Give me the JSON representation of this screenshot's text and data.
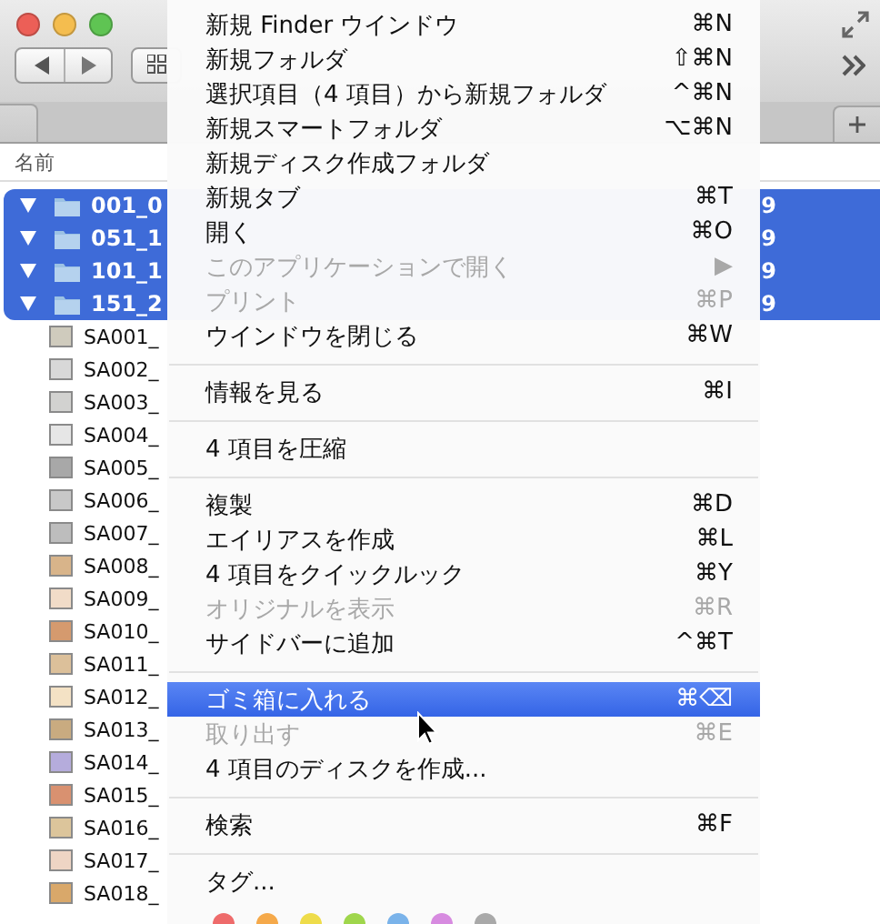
{
  "finder": {
    "column_header": "名前",
    "rows": [
      {
        "kind": "folder",
        "name": "001_0",
        "expanded": true,
        "selected": true,
        "column_2": "9"
      },
      {
        "kind": "folder",
        "name": "051_1",
        "expanded": true,
        "selected": true,
        "column_2": "9"
      },
      {
        "kind": "folder",
        "name": "101_1",
        "expanded": true,
        "selected": true,
        "column_2": "9"
      },
      {
        "kind": "folder",
        "name": "151_2",
        "expanded": true,
        "selected": true,
        "column_2": "9"
      },
      {
        "kind": "file",
        "name": "SA001_",
        "selected": false,
        "color": "#cfcbbd"
      },
      {
        "kind": "file",
        "name": "SA002_",
        "selected": false,
        "color": "#d8d8d8"
      },
      {
        "kind": "file",
        "name": "SA003_",
        "selected": false,
        "color": "#d2d2d0"
      },
      {
        "kind": "file",
        "name": "SA004_",
        "selected": false,
        "color": "#e6e6e6"
      },
      {
        "kind": "file",
        "name": "SA005_",
        "selected": false,
        "color": "#a8a8a8"
      },
      {
        "kind": "file",
        "name": "SA006_",
        "selected": false,
        "color": "#c8c8c8"
      },
      {
        "kind": "file",
        "name": "SA007_",
        "selected": false,
        "color": "#bdbdbd"
      },
      {
        "kind": "file",
        "name": "SA008_",
        "selected": false,
        "color": "#d8b48a"
      },
      {
        "kind": "file",
        "name": "SA009_",
        "selected": false,
        "color": "#f1dcc8"
      },
      {
        "kind": "file",
        "name": "SA010_",
        "selected": false,
        "color": "#d59a6e"
      },
      {
        "kind": "file",
        "name": "SA011_",
        "selected": false,
        "color": "#dcc09a"
      },
      {
        "kind": "file",
        "name": "SA012_",
        "selected": false,
        "color": "#f4e2c5"
      },
      {
        "kind": "file",
        "name": "SA013_",
        "selected": false,
        "color": "#c9ab80"
      },
      {
        "kind": "file",
        "name": "SA014_",
        "selected": false,
        "color": "#b5acdc"
      },
      {
        "kind": "file",
        "name": "SA015_",
        "selected": false,
        "color": "#d99170"
      },
      {
        "kind": "file",
        "name": "SA016_",
        "selected": false,
        "color": "#dcc59b"
      },
      {
        "kind": "file",
        "name": "SA017_",
        "selected": false,
        "color": "#eed5c4"
      },
      {
        "kind": "file",
        "name": "SA018_",
        "selected": false,
        "color": "#d9a86a"
      }
    ]
  },
  "context_menu": {
    "items": [
      {
        "kind": "item",
        "label": "新規 Finder ウインドウ",
        "shortcut": "⌘N",
        "disabled": false,
        "selected": false
      },
      {
        "kind": "item",
        "label": "新規フォルダ",
        "shortcut": "⇧⌘N",
        "disabled": false,
        "selected": false
      },
      {
        "kind": "item",
        "label": "選択項目（4 項目）から新規フォルダ",
        "shortcut": "^⌘N",
        "disabled": false,
        "selected": false
      },
      {
        "kind": "item",
        "label": "新規スマートフォルダ",
        "shortcut": "⌥⌘N",
        "disabled": false,
        "selected": false
      },
      {
        "kind": "item",
        "label": "新規ディスク作成フォルダ",
        "disabled": false,
        "selected": false
      },
      {
        "kind": "item",
        "label": "新規タブ",
        "shortcut": "⌘T",
        "disabled": false,
        "selected": false
      },
      {
        "kind": "item",
        "label": "開く",
        "shortcut": "⌘O",
        "disabled": false,
        "selected": false
      },
      {
        "kind": "item",
        "label": "このアプリケーションで開く",
        "shortcut": "▶",
        "disabled": true,
        "selected": false
      },
      {
        "kind": "item",
        "label": "プリント",
        "shortcut": "⌘P",
        "disabled": true,
        "selected": false
      },
      {
        "kind": "item",
        "label": "ウインドウを閉じる",
        "shortcut": "⌘W",
        "disabled": false,
        "selected": false
      },
      {
        "kind": "separator"
      },
      {
        "kind": "item",
        "label": "情報を見る",
        "shortcut": "⌘I",
        "disabled": false,
        "selected": false
      },
      {
        "kind": "separator"
      },
      {
        "kind": "item",
        "label": "4 項目を圧縮",
        "disabled": false,
        "selected": false
      },
      {
        "kind": "separator"
      },
      {
        "kind": "item",
        "label": "複製",
        "shortcut": "⌘D",
        "disabled": false,
        "selected": false
      },
      {
        "kind": "item",
        "label": "エイリアスを作成",
        "shortcut": "⌘L",
        "disabled": false,
        "selected": false
      },
      {
        "kind": "item",
        "label": "4 項目をクイックルック",
        "shortcut": "⌘Y",
        "disabled": false,
        "selected": false
      },
      {
        "kind": "item",
        "label": "オリジナルを表示",
        "shortcut": "⌘R",
        "disabled": true,
        "selected": false
      },
      {
        "kind": "item",
        "label": "サイドバーに追加",
        "shortcut": "^⌘T",
        "disabled": false,
        "selected": false
      },
      {
        "kind": "separator"
      },
      {
        "kind": "item",
        "label": "ゴミ箱に入れる",
        "shortcut": "⌘⌫",
        "disabled": false,
        "selected": true
      },
      {
        "kind": "item",
        "label": "取り出す",
        "shortcut": "⌘E",
        "disabled": true,
        "selected": false
      },
      {
        "kind": "item",
        "label": "4 項目のディスクを作成...",
        "disabled": false,
        "selected": false
      },
      {
        "kind": "separator"
      },
      {
        "kind": "item",
        "label": "検索",
        "shortcut": "⌘F",
        "disabled": false,
        "selected": false
      },
      {
        "kind": "separator"
      },
      {
        "kind": "item",
        "label": "タグ...",
        "disabled": false,
        "selected": false
      },
      {
        "kind": "tags",
        "tags": [
          {
            "color": "#ee6b6b"
          },
          {
            "color": "#f5a94a"
          },
          {
            "color": "#eedc4a"
          },
          {
            "color": "#9fd64c"
          },
          {
            "color": "#7ab3ea"
          },
          {
            "color": "#d78be0"
          },
          {
            "color": "#a9a9a9"
          }
        ]
      }
    ]
  }
}
